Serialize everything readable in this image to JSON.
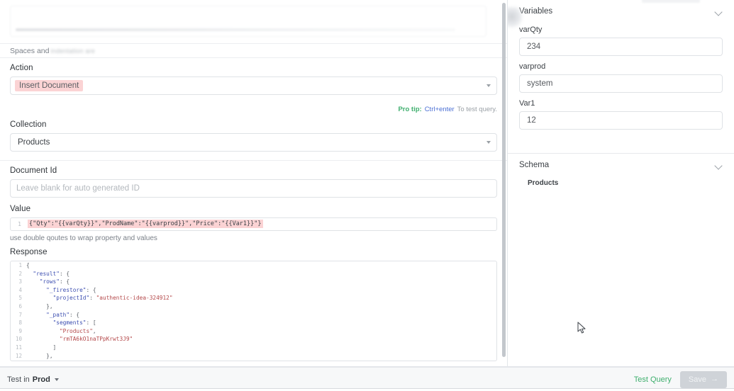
{
  "left": {
    "spaces_note": "Spaces and",
    "spaces_note_blurred": "indentation are",
    "action": {
      "label": "Action",
      "value": "Insert Document"
    },
    "protip": {
      "label": "Pro tip:",
      "key": "Ctrl+enter",
      "tail": "To test query."
    },
    "collection": {
      "label": "Collection",
      "value": "Products"
    },
    "document_id": {
      "label": "Document Id",
      "placeholder": "Leave blank for auto generated ID",
      "value": ""
    },
    "value_field": {
      "label": "Value",
      "line_number": "1",
      "code": "{\"Qty\":\"{{varQty}}\",\"ProdName\":\"{{varprod}}\",\"Price\":\"{{Var1}}\"}",
      "hint": "use double qoutes to wrap property and values"
    },
    "response": {
      "label": "Response",
      "lines": [
        {
          "n": "1",
          "text": "{"
        },
        {
          "n": "2",
          "text": "  \"result\": {"
        },
        {
          "n": "3",
          "text": "    \"rows\": {"
        },
        {
          "n": "4",
          "text": "      \"_firestore\": {"
        },
        {
          "n": "5",
          "text": "        \"projectId\": \"authentic-idea-324912\""
        },
        {
          "n": "6",
          "text": "      },"
        },
        {
          "n": "7",
          "text": "      \"_path\": {"
        },
        {
          "n": "8",
          "text": "        \"segments\": ["
        },
        {
          "n": "9",
          "text": "          \"Products\","
        },
        {
          "n": "10",
          "text": "          \"rmTA6kO1naTPpKrwt3J9\""
        },
        {
          "n": "11",
          "text": "        ]"
        },
        {
          "n": "12",
          "text": "      },"
        }
      ]
    }
  },
  "right": {
    "variables": {
      "title": "Variables",
      "collapse_icon": "chevron-down-icon",
      "items": [
        {
          "name": "varQty",
          "value": "234"
        },
        {
          "name": "varprod",
          "value": "system"
        },
        {
          "name": "Var1",
          "value": "12"
        }
      ]
    },
    "schema": {
      "title": "Schema",
      "collapse_icon": "chevron-down-icon",
      "items": [
        "Products"
      ]
    }
  },
  "footer": {
    "test_in_prefix": "Test in",
    "environment": "Prod",
    "env_caret_icon": "caret-down-icon",
    "test_query_label": "Test Query",
    "save_label": "Save",
    "save_arrow_icon": "arrow-right-icon"
  },
  "colors": {
    "accent_green": "#3faf6e",
    "link_blue": "#4a6fd4",
    "highlight_pink": "#fbd3d4",
    "border": "#dfe2e6",
    "text": "#3c4146",
    "muted": "#9aa0a6",
    "save_disabled": "#cfd3d8"
  }
}
